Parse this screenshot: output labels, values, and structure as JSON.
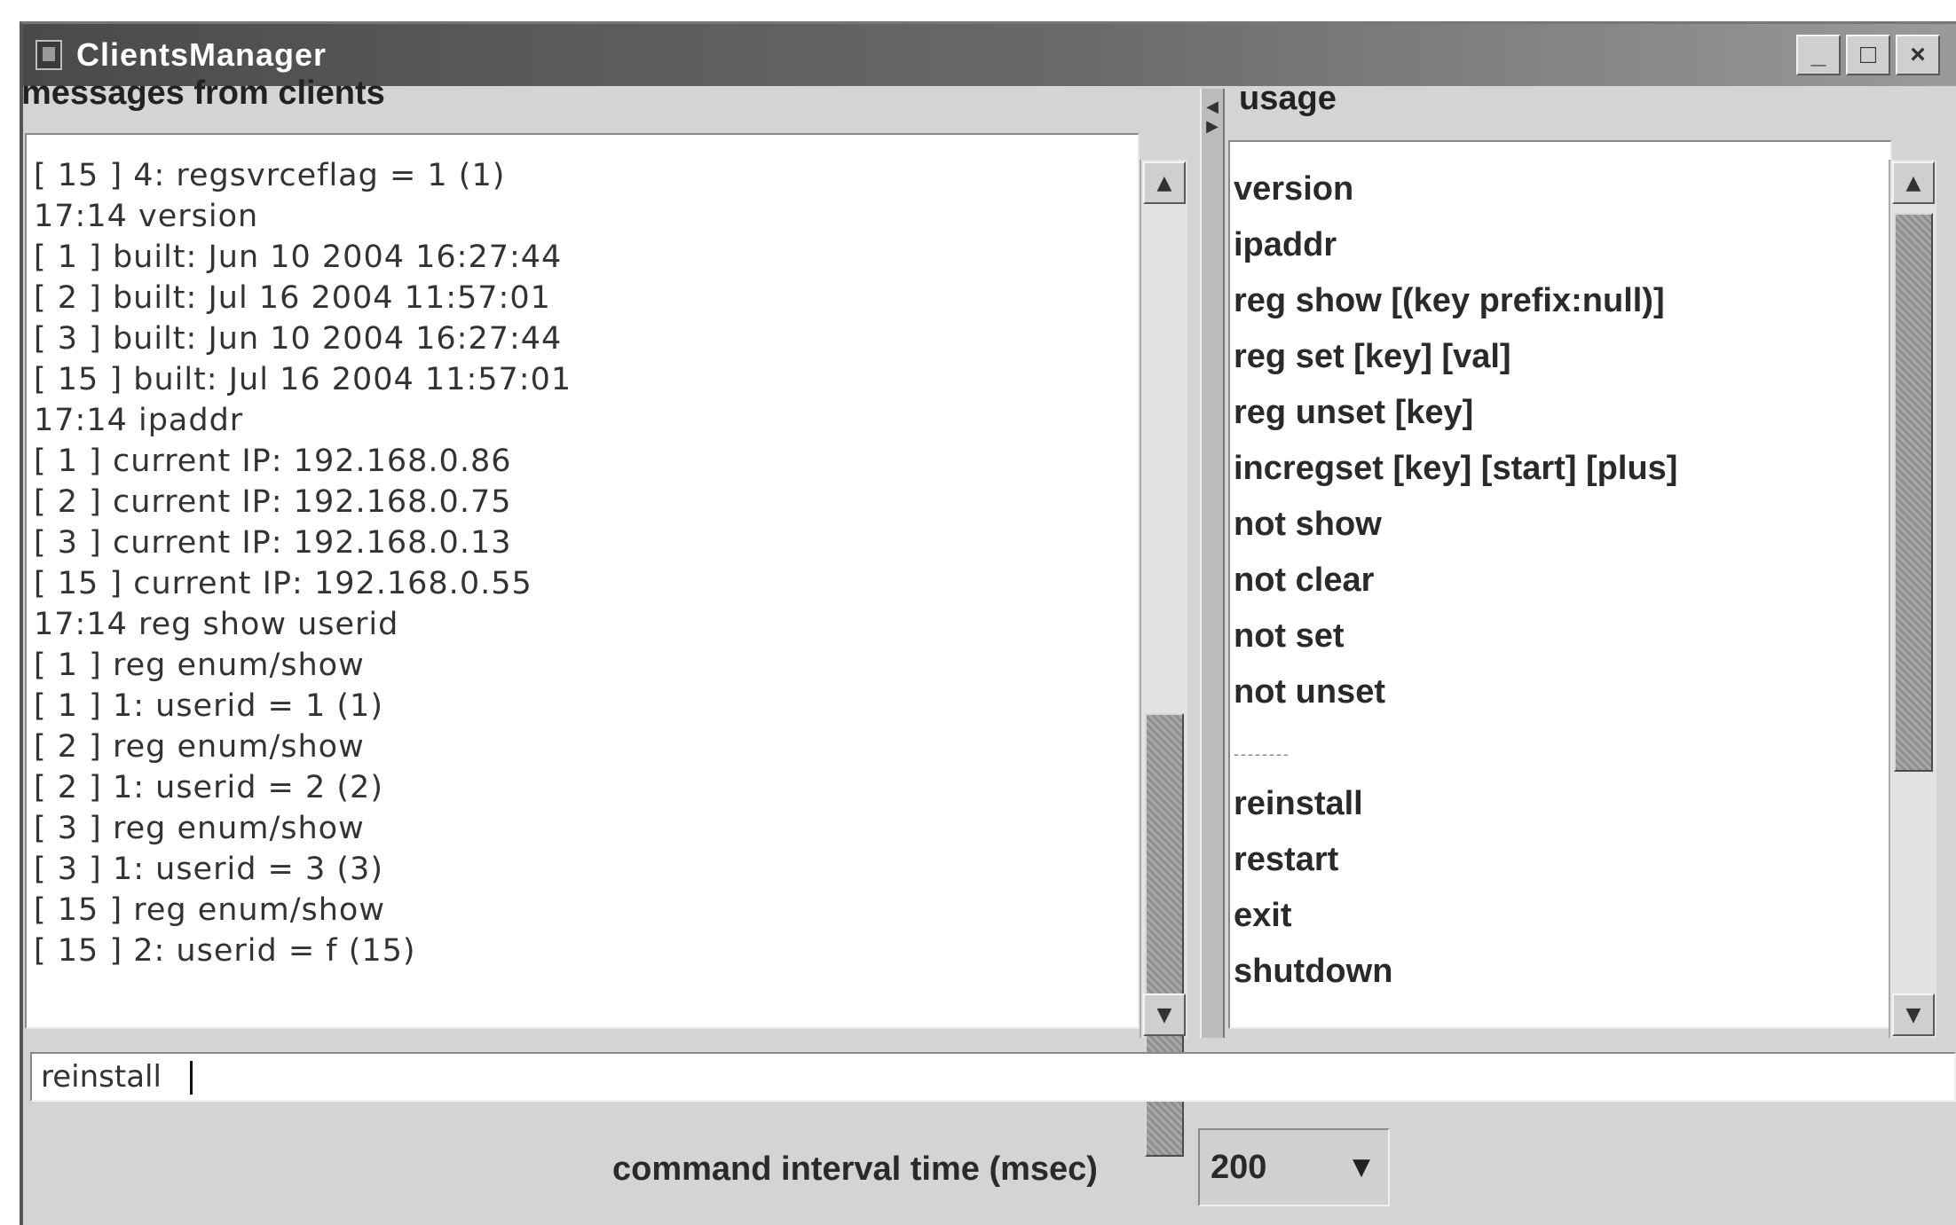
{
  "window": {
    "title": "ClientsManager",
    "minimize_label": "_",
    "maximize_label": "□",
    "close_label": "×"
  },
  "messages_panel": {
    "header": "messages from clients",
    "lines": [
      "[ 15 ] 4: regsvrceflag = 1 (1)",
      "17:14  version",
      "[ 1 ] built: Jun 10 2004 16:27:44",
      "[ 2 ] built: Jul 16 2004 11:57:01",
      "[ 3 ] built: Jun 10 2004 16:27:44",
      "[ 15 ] built: Jul 16 2004 11:57:01",
      "17:14  ipaddr",
      "[ 1 ] current IP: 192.168.0.86",
      "[ 2 ] current IP: 192.168.0.75",
      "[ 3 ] current IP: 192.168.0.13",
      "[ 15 ] current IP: 192.168.0.55",
      "17:14  reg show userid",
      "[ 1 ] reg enum/show",
      "[ 1 ] 1: userid = 1 (1)",
      "[ 2 ] reg enum/show",
      "[ 2 ] 1: userid = 2 (2)",
      "[ 3 ] reg enum/show",
      "[ 3 ] 1: userid = 3 (3)",
      "[ 15 ] reg enum/show",
      "[ 15 ] 2: userid = f (15)"
    ]
  },
  "usage_panel": {
    "header": "usage",
    "lines": [
      "version",
      "ipaddr",
      "reg show [(key prefix:null)]",
      "reg set [key] [val]",
      "reg unset [key]",
      "incregset [key] [start] [plus]",
      "not show",
      "not clear",
      "not set",
      "not unset",
      "--------",
      "reinstall",
      "restart",
      "exit",
      "shutdown"
    ]
  },
  "command": {
    "value": "reinstall"
  },
  "interval": {
    "label": "command interval time (msec)",
    "value": "200"
  },
  "icons": {
    "scroll_up": "▲",
    "scroll_down": "▼",
    "dropdown": "▼",
    "divider_left": "◀",
    "divider_right": "▶"
  }
}
